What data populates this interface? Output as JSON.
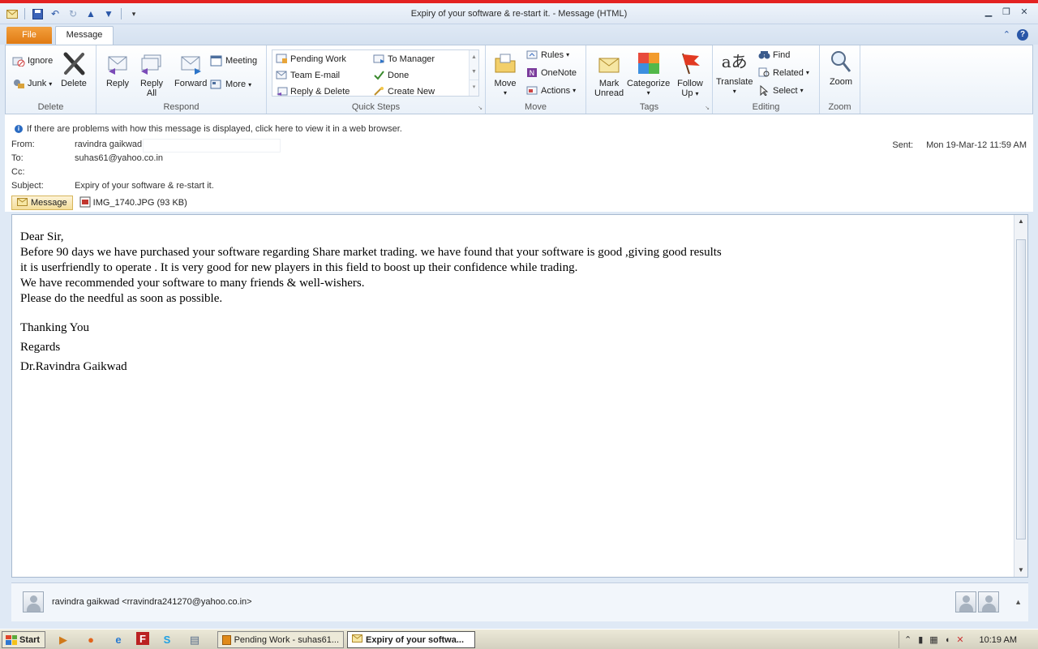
{
  "window": {
    "title": "Expiry of your software &  re-start it.  - Message (HTML)"
  },
  "tabs": {
    "file": "File",
    "message": "Message"
  },
  "ribbon": {
    "delete": {
      "label": "Delete",
      "ignore": "Ignore",
      "junk": "Junk",
      "delete": "Delete"
    },
    "respond": {
      "label": "Respond",
      "reply": "Reply",
      "reply_all_1": "Reply",
      "reply_all_2": "All",
      "forward": "Forward",
      "meeting": "Meeting",
      "more": "More"
    },
    "quick_steps": {
      "label": "Quick Steps",
      "items": [
        "Pending Work",
        "Team E-mail",
        "Reply & Delete",
        "To Manager",
        "Done",
        "Create New"
      ]
    },
    "move": {
      "label": "Move",
      "move": "Move",
      "rules": "Rules",
      "onenote": "OneNote",
      "actions": "Actions"
    },
    "tags": {
      "label": "Tags",
      "mark_unread_1": "Mark",
      "mark_unread_2": "Unread",
      "categorize": "Categorize",
      "follow_up_1": "Follow",
      "follow_up_2": "Up"
    },
    "editing": {
      "label": "Editing",
      "translate": "Translate",
      "find": "Find",
      "related": "Related",
      "select": "Select"
    },
    "zoom": {
      "label": "Zoom",
      "zoom": "Zoom"
    }
  },
  "header": {
    "info": "If there are problems with how this message is displayed, click here to view it in a web browser.",
    "from_label": "From:",
    "from": "ravindra gaikwad",
    "to_label": "To:",
    "to": "suhas61@yahoo.co.in",
    "cc_label": "Cc:",
    "cc": "",
    "subject_label": "Subject:",
    "subject": "Expiry of your software &  re-start it.",
    "sent_label": "Sent:",
    "sent": "Mon 19-Mar-12 11:59 AM",
    "message_tab": "Message",
    "attachment": "IMG_1740.JPG (93 KB)"
  },
  "body": {
    "lines": [
      "Dear Sir,",
      "Before 90 days we have purchased your software regarding Share market trading. we have found that your software is good ,giving good results",
      "it is userfriendly to operate . It is very good for new players in this field to boost up their confidence while trading.",
      "We have recommended your software to many friends & well-wishers.",
      "Please do the needful as soon as possible."
    ],
    "thanks": "Thanking You",
    "regards": "Regards",
    "signature": "Dr.Ravindra Gaikwad"
  },
  "people_pane": {
    "person": "ravindra gaikwad <rravindra241270@yahoo.co.in>"
  },
  "taskbar": {
    "start": "Start",
    "tasks": [
      {
        "label": "Pending Work - suhas61...",
        "active": false
      },
      {
        "label": "Expiry of your softwa...",
        "active": true
      }
    ],
    "clock": "10:19 AM"
  },
  "colors": {
    "file_tab": "#e07a12",
    "accent": "#2a57a8",
    "title_strip": "#e32222"
  }
}
